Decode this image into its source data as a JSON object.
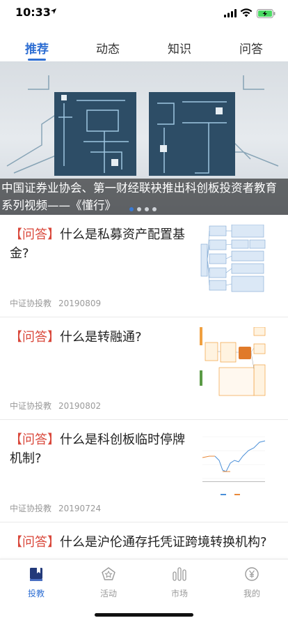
{
  "status_bar": {
    "time": "10:33"
  },
  "tabs": [
    {
      "label": "推荐",
      "active": true
    },
    {
      "label": "动态",
      "active": false
    },
    {
      "label": "知识",
      "active": false
    },
    {
      "label": "问答",
      "active": false
    }
  ],
  "banner": {
    "art_text": "懂行",
    "caption": "中国证券业协会、第一财经联袂推出科创板投资者教育系列视频——《懂行》",
    "slide_index": 1,
    "slide_count": 4
  },
  "articles": [
    {
      "tag": "【问答】",
      "title": "什么是私募资产配置基金?",
      "source": "中证协投教",
      "date": "20190809"
    },
    {
      "tag": "【问答】",
      "title": "什么是转融通?",
      "source": "中证协投教",
      "date": "20190802"
    },
    {
      "tag": "【问答】",
      "title": "什么是科创板临时停牌机制?",
      "source": "中证协投教",
      "date": "20190724"
    },
    {
      "tag": "【问答】",
      "title": "什么是沪伦通存托凭证跨境转换机构?"
    }
  ],
  "bottom_nav": [
    {
      "label": "投教",
      "icon": "book-icon",
      "active": true
    },
    {
      "label": "活动",
      "icon": "pentagon-star-icon",
      "active": false
    },
    {
      "label": "市场",
      "icon": "bars-icon",
      "active": false
    },
    {
      "label": "我的",
      "icon": "yen-circle-icon",
      "active": false
    }
  ],
  "colors": {
    "accent": "#2f6fd3",
    "tag_red": "#d9473a",
    "meta_gray": "#9a9a9a"
  }
}
